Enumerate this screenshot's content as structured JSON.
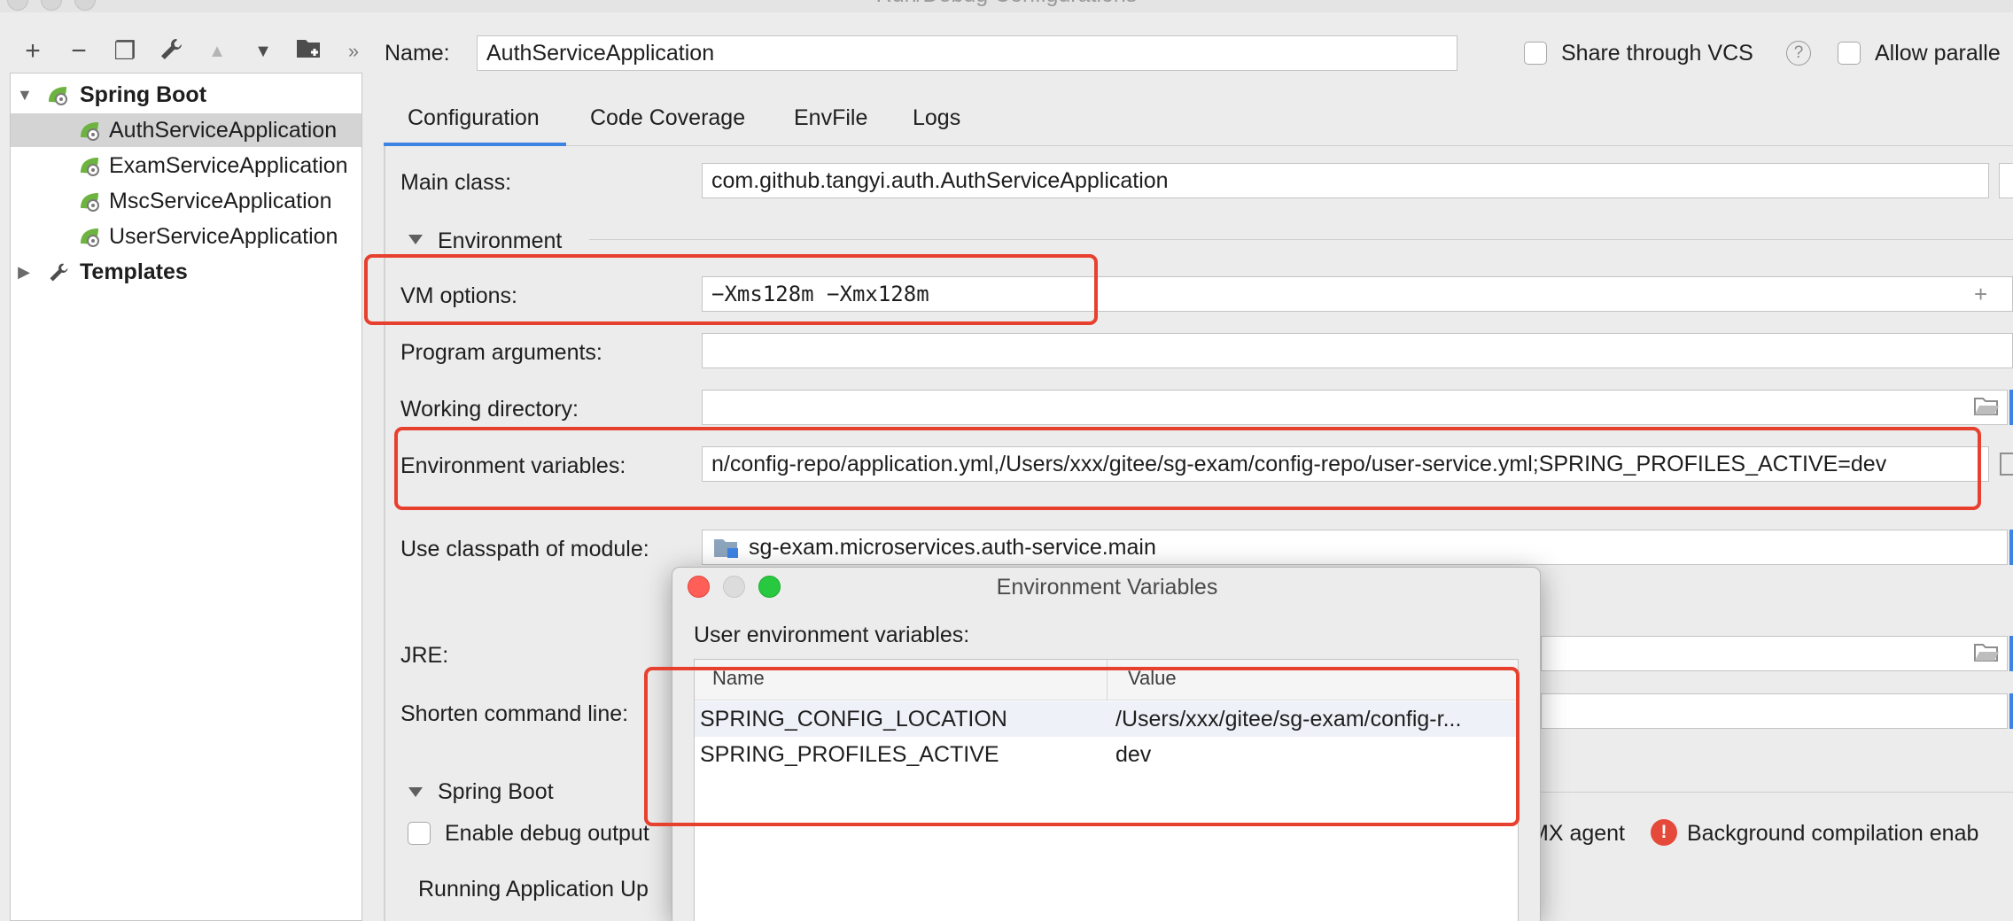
{
  "window": {
    "title": "Run/Debug Configurations"
  },
  "toolbar": {
    "add_icon": "+",
    "remove_icon": "−",
    "copy_icon": "❐",
    "settings_icon": "🔧",
    "move_up_icon": "▲",
    "move_down_icon": "▼",
    "new_folder_icon": "⊞",
    "more_icon": "»"
  },
  "tree": {
    "groups": [
      {
        "label": "Spring Boot",
        "expanded": true,
        "items": [
          "AuthServiceApplication",
          "ExamServiceApplication",
          "MscServiceApplication",
          "UserServiceApplication"
        ],
        "selected_index": 0
      },
      {
        "label": "Templates",
        "expanded": false
      }
    ]
  },
  "header": {
    "name_label": "Name:",
    "name_value": "AuthServiceApplication",
    "share_vcs_label": "Share through VCS",
    "help_glyph": "?",
    "allow_parallel_label": "Allow paralle"
  },
  "tabs": [
    "Configuration",
    "Code Coverage",
    "EnvFile",
    "Logs"
  ],
  "config": {
    "main_class_label": "Main class:",
    "main_class_value": "com.github.tangyi.auth.AuthServiceApplication",
    "environment_section": "Environment",
    "vm_options_label": "VM options:",
    "vm_options_value": "−Xms128m −Xmx128m",
    "vm_expand_glyph": "+",
    "program_args_label": "Program arguments:",
    "program_args_value": "",
    "working_dir_label": "Working directory:",
    "working_dir_value": "",
    "env_vars_label": "Environment variables:",
    "env_vars_value": "n/config-repo/application.yml,/Users/xxx/gitee/sg-exam/config-repo/user-service.yml;SPRING_PROFILES_ACTIVE=dev",
    "classpath_label": "Use classpath of module:",
    "classpath_value": "sg-exam.microservices.auth-service.main",
    "jre_label": "JRE:",
    "shorten_label": "Shorten command line:",
    "spring_boot_section": "Spring Boot",
    "enable_debug_label": "Enable debug output",
    "jmx_agent_label": "MX agent",
    "bg_compilation_label": "Background compilation enab",
    "error_glyph": "!",
    "running_update_label": "Running Application Up"
  },
  "dialog": {
    "title": "Environment Variables",
    "subtitle": "User environment variables:",
    "columns": [
      "Name",
      "Value"
    ],
    "rows": [
      {
        "name": "SPRING_CONFIG_LOCATION",
        "value": "/Users/xxx/gitee/sg-exam/config-r..."
      },
      {
        "name": "SPRING_PROFILES_ACTIVE",
        "value": "dev"
      }
    ]
  },
  "colors": {
    "accent": "#3d83e3",
    "highlight": "#e8402e",
    "spring_green": "#6db33f",
    "error": "#e5493a"
  }
}
